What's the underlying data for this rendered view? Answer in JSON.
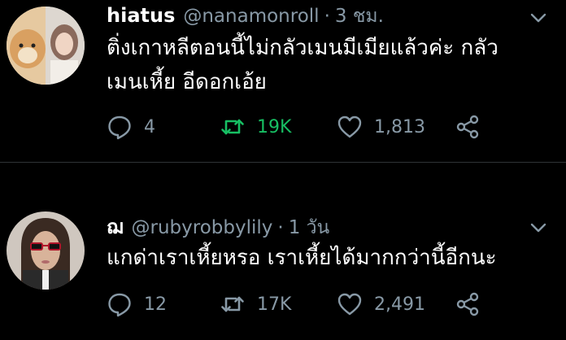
{
  "tweets": [
    {
      "display_name": "hiatus",
      "handle": "@nanamonroll",
      "separator": "·",
      "time": "3 ชม.",
      "text_lines": [
        "ติ่งเกาหลีตอนนี้ไม่กลัวเมนมีเมียแล้วค่ะ กลัว",
        "เมนเหี้ย อีดอกเอ้ย"
      ],
      "replies": "4",
      "retweets": "19K",
      "likes": "1,813",
      "retweeted": true
    },
    {
      "display_name": "ฌ",
      "handle": "@rubyrobbylily",
      "separator": "·",
      "time": "1 วัน",
      "text_lines": [
        "แกด่าเราเหี้ยหรอ เราเหี้ยได้มากกว่านี้อีกนะ"
      ],
      "replies": "12",
      "retweets": "17K",
      "likes": "2,491",
      "retweeted": false
    }
  ],
  "colors": {
    "background": "#000000",
    "secondary_text": "#8899a6",
    "retweet_active": "#17bf63",
    "divider": "#2f3336"
  },
  "icons": [
    "reply-icon",
    "retweet-icon",
    "like-icon",
    "share-icon",
    "chevron-down-icon"
  ]
}
